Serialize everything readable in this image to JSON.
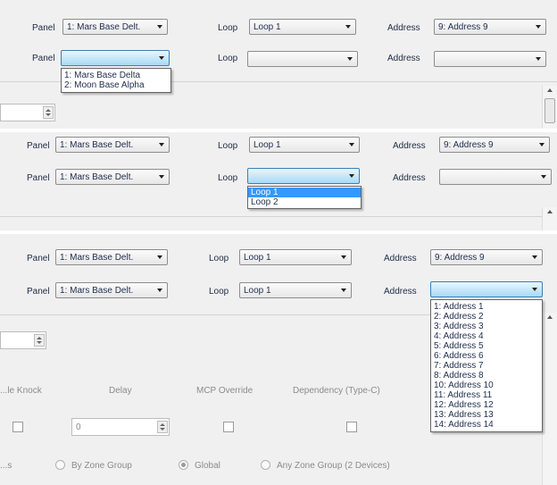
{
  "labels": {
    "panel": "Panel",
    "loop": "Loop",
    "address": "Address"
  },
  "values": {
    "panel_selected": "1: Mars Base Delt.",
    "loop_selected": "Loop 1",
    "address_selected": "9: Address 9"
  },
  "panel_options": [
    "1: Mars Base Delta",
    "2: Moon Base Alpha"
  ],
  "loop_options": [
    "Loop 1",
    "Loop 2"
  ],
  "address_options": [
    "1: Address 1",
    "2: Address 2",
    "3: Address 3",
    "4: Address 4",
    "5: Address 5",
    "6: Address 6",
    "7: Address 7",
    "8: Address 8",
    "10: Address 10",
    "11: Address 11",
    "12: Address 12",
    "13: Address 13",
    "14: Address 14"
  ],
  "lower_form": {
    "cols": [
      "...le Knock",
      "Delay",
      "MCP Override",
      "Dependency (Type-C)"
    ],
    "delay_value": "0",
    "radio_prefix": "...s",
    "radios": [
      "By Zone Group",
      "Global",
      "Any Zone Group (2 Devices)"
    ]
  },
  "colors": {
    "selection": "#3399ff",
    "active_combo": "#a7d9f5"
  }
}
